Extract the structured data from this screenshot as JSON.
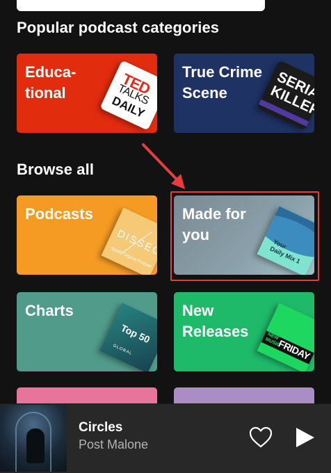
{
  "sections": {
    "popular_title": "Popular podcast categories",
    "browse_title": "Browse all"
  },
  "popular": [
    {
      "label": "Educa-\ntional",
      "color": "#e22c0e",
      "art": "ted-talks-daily-cover",
      "art_text": {
        "l1": "TED",
        "l2": "TALKS",
        "l3": "DAILY"
      }
    },
    {
      "label": "True Crime\nScene",
      "color": "#1e3264",
      "art": "serial-killers-cover",
      "art_text": {
        "l1": "SERIAL",
        "l2": "KILLERS"
      }
    }
  ],
  "browse": [
    {
      "label": "Podcasts",
      "color": "#f59b23",
      "art": "dissect-cover",
      "art_text": {
        "l1": "DISSECT",
        "l2": "Spotify Original Podcast"
      }
    },
    {
      "label": "Made for\nyou",
      "color": "#8aa0aa",
      "art": "daily-mix-cover",
      "art_text": {
        "l1": "Your",
        "l2": "Daily Mix 1"
      }
    },
    {
      "label": "Charts",
      "color": "#509b8a",
      "art": "top-50-cover",
      "art_text": {
        "l1": "Top 50",
        "l2": "GLOBAL"
      }
    },
    {
      "label": "New\nReleases",
      "color": "#1fb96a",
      "art": "new-music-friday-cover",
      "art_text": {
        "l1": "NEW\nMUSIC",
        "l2": "FRIDAY"
      }
    },
    {
      "label": "",
      "color": "#e8739b"
    },
    {
      "label": "",
      "color": "#a98dc4"
    }
  ],
  "player": {
    "title": "Circles",
    "artist": "Post Malone",
    "album_art": "circles-album-art"
  },
  "annotation": {
    "highlight_color": "#e53e3e",
    "target": "Made for you"
  }
}
